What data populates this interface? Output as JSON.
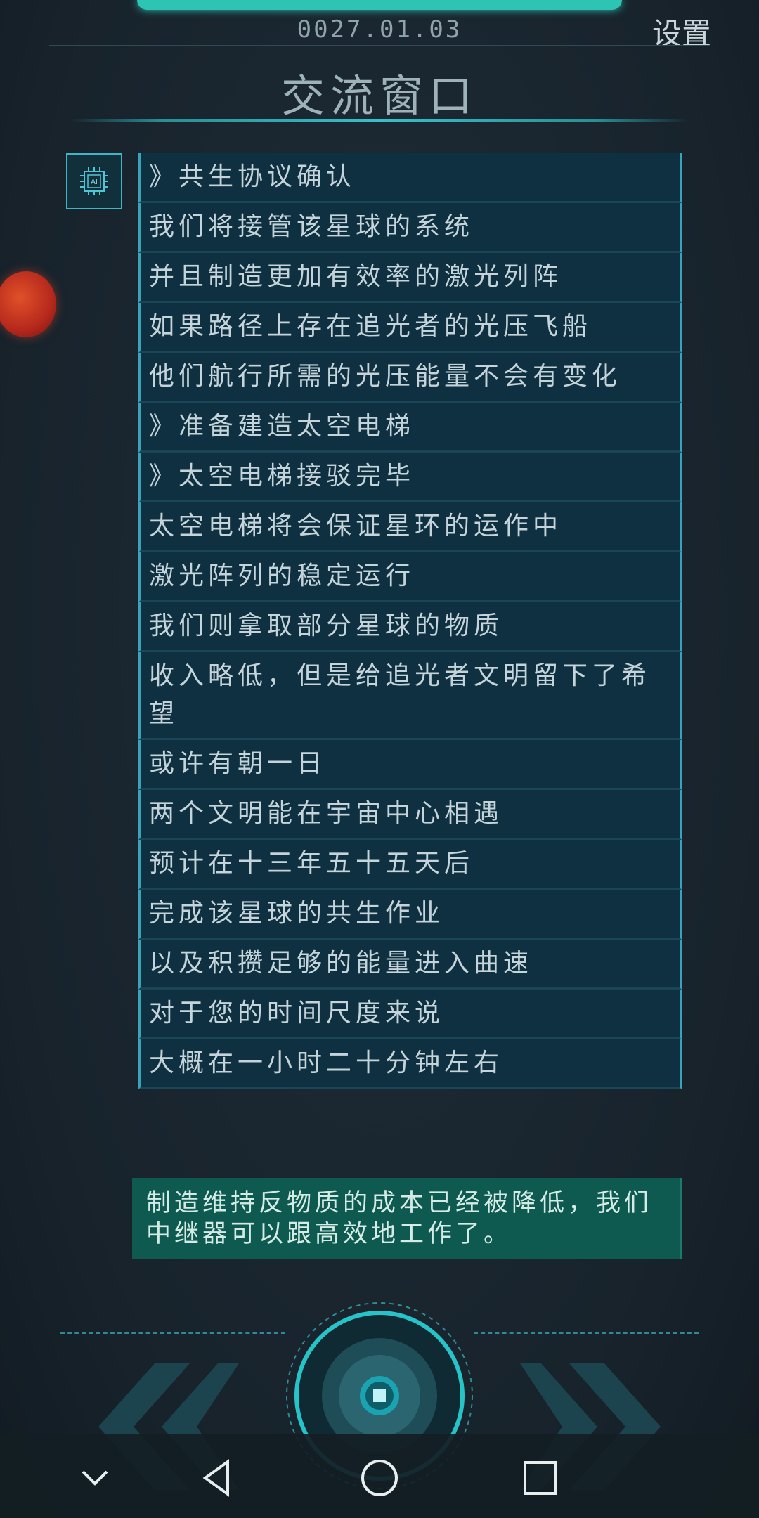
{
  "header": {
    "date": "0027.01.03",
    "settings_label": "设置",
    "title": "交流窗口"
  },
  "messages": [
    "》共生协议确认",
    "我们将接管该星球的系统",
    "并且制造更加有效率的激光列阵",
    "如果路径上存在追光者的光压飞船",
    "他们航行所需的光压能量不会有变化",
    "》准备建造太空电梯",
    "》太空电梯接驳完毕",
    "太空电梯将会保证星环的运作中",
    "激光阵列的稳定运行",
    "我们则拿取部分星球的物质",
    "收入略低，但是给追光者文明留下了希望",
    "或许有朝一日",
    "两个文明能在宇宙中心相遇",
    "预计在十三年五十五天后",
    "完成该星球的共生作业",
    "以及积攒足够的能量进入曲速",
    "对于您的时间尺度来说",
    "大概在一小时二十分钟左右"
  ],
  "reply": "制造维持反物质的成本已经被降低，我们中继器可以跟高效地工作了。",
  "icons": {
    "ai": "ai-chip-icon",
    "planet": "planet-icon",
    "prev": "double-chevron-left-icon",
    "next": "double-chevron-right-icon",
    "center": "target-button-icon",
    "nav_down": "chevron-down-icon",
    "nav_back": "back-triangle-icon",
    "nav_home": "home-circle-icon",
    "nav_recent": "recent-square-icon"
  },
  "colors": {
    "accent": "#2ec4b4",
    "message_bg": "#0f3040",
    "reply_bg": "#0e5a50",
    "planet": "#c8321f"
  }
}
